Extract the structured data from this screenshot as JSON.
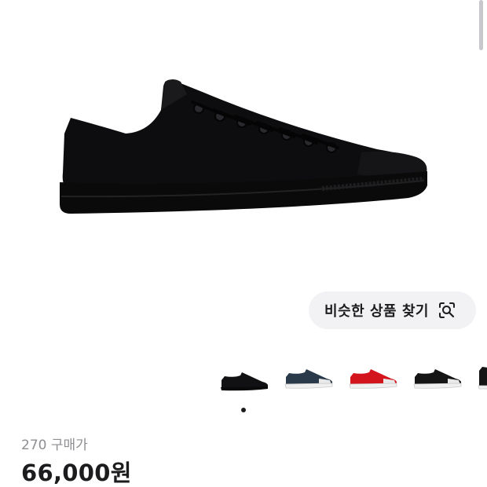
{
  "product": {
    "image_icon": "low-top-canvas-sneaker",
    "image_color": "#0b0b0d"
  },
  "similar_search": {
    "label": "비슷한 상품 찾기",
    "icon": "image-search-icon"
  },
  "color_options": [
    {
      "name": "black-mono",
      "upper": "#111113",
      "sole": "#111113",
      "selected": true
    },
    {
      "name": "navy",
      "upper": "#2b3a4a",
      "sole": "#f2f2f2",
      "selected": false
    },
    {
      "name": "red",
      "upper": "#d3141c",
      "sole": "#f2f2f2",
      "selected": false
    },
    {
      "name": "black-white",
      "upper": "#151515",
      "sole": "#f2f2f2",
      "selected": false
    },
    {
      "name": "partial",
      "upper": "#151515",
      "sole": "#f2f2f2",
      "selected": false
    }
  ],
  "carousel": {
    "dots": 1,
    "active": 0
  },
  "purchase_info": {
    "size_label": "270",
    "type_label": "구매가",
    "price": "66,000원"
  }
}
